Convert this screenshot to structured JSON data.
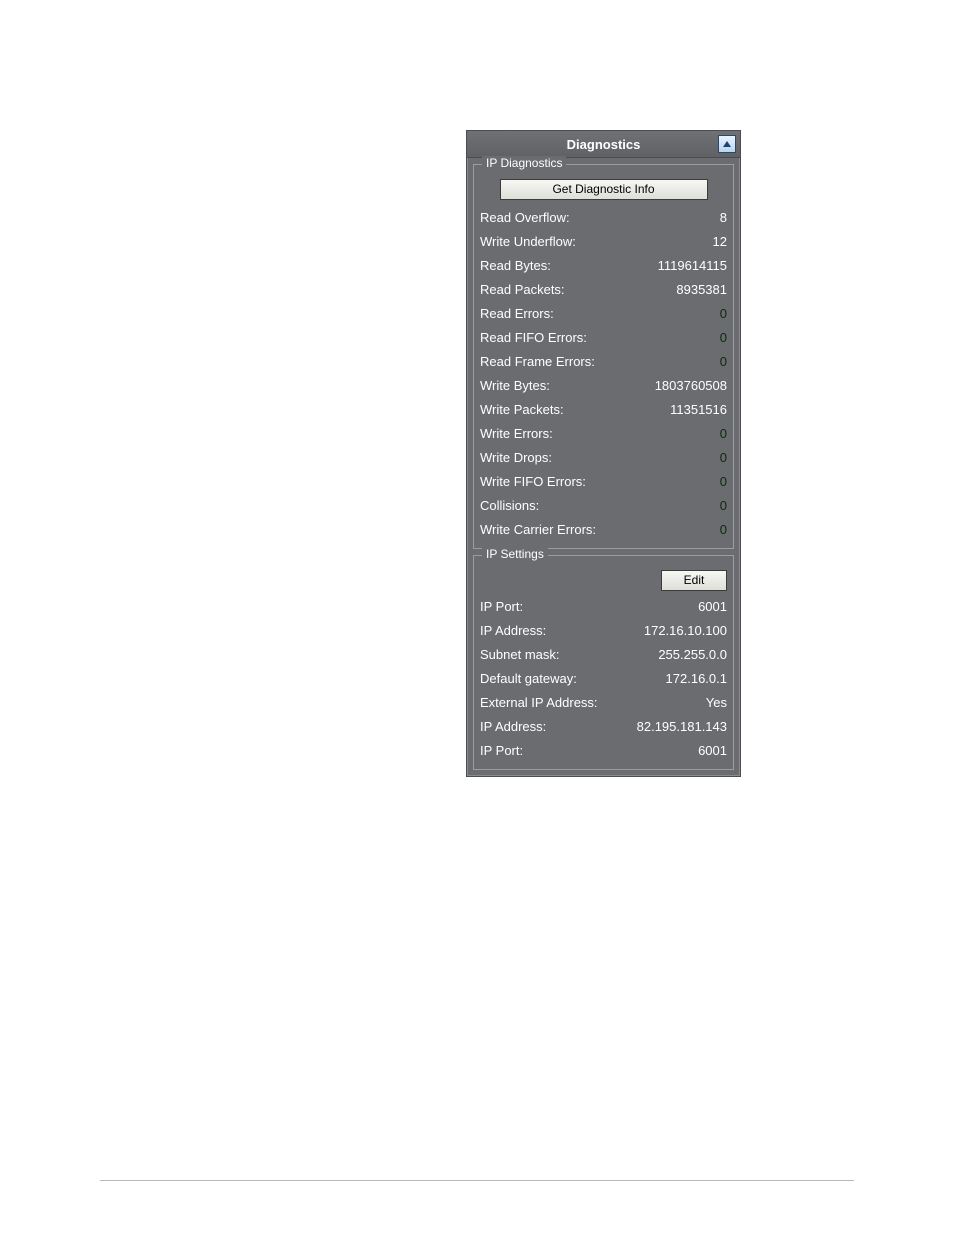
{
  "panel": {
    "title": "Diagnostics",
    "collapse_icon": "arrow-up-icon"
  },
  "diagnostics": {
    "legend": "IP Diagnostics",
    "get_button_label": "Get Diagnostic Info",
    "rows": [
      {
        "label": "Read Overflow:",
        "value": "8",
        "zero": false
      },
      {
        "label": "Write Underflow:",
        "value": "12",
        "zero": false
      },
      {
        "label": "Read Bytes:",
        "value": "1119614115",
        "zero": false
      },
      {
        "label": "Read Packets:",
        "value": "8935381",
        "zero": false
      },
      {
        "label": "Read Errors:",
        "value": "0",
        "zero": true
      },
      {
        "label": "Read FIFO Errors:",
        "value": "0",
        "zero": true
      },
      {
        "label": "Read Frame Errors:",
        "value": "0",
        "zero": true
      },
      {
        "label": "Write Bytes:",
        "value": "1803760508",
        "zero": false
      },
      {
        "label": "Write Packets:",
        "value": "11351516",
        "zero": false
      },
      {
        "label": "Write Errors:",
        "value": "0",
        "zero": true
      },
      {
        "label": "Write Drops:",
        "value": "0",
        "zero": true
      },
      {
        "label": "Write FIFO Errors:",
        "value": "0",
        "zero": true
      },
      {
        "label": "Collisions:",
        "value": "0",
        "zero": true
      },
      {
        "label": "Write Carrier Errors:",
        "value": "0",
        "zero": true
      }
    ]
  },
  "settings": {
    "legend": "IP Settings",
    "edit_button_label": "Edit",
    "rows": [
      {
        "label": "IP Port:",
        "value": "6001"
      },
      {
        "label": "IP Address:",
        "value": "172.16.10.100"
      },
      {
        "label": "Subnet mask:",
        "value": "255.255.0.0"
      },
      {
        "label": "Default gateway:",
        "value": "172.16.0.1"
      },
      {
        "label": "External IP Address:",
        "value": "Yes"
      },
      {
        "label": "IP Address:",
        "value": "82.195.181.143"
      },
      {
        "label": "IP Port:",
        "value": "6001"
      }
    ]
  }
}
